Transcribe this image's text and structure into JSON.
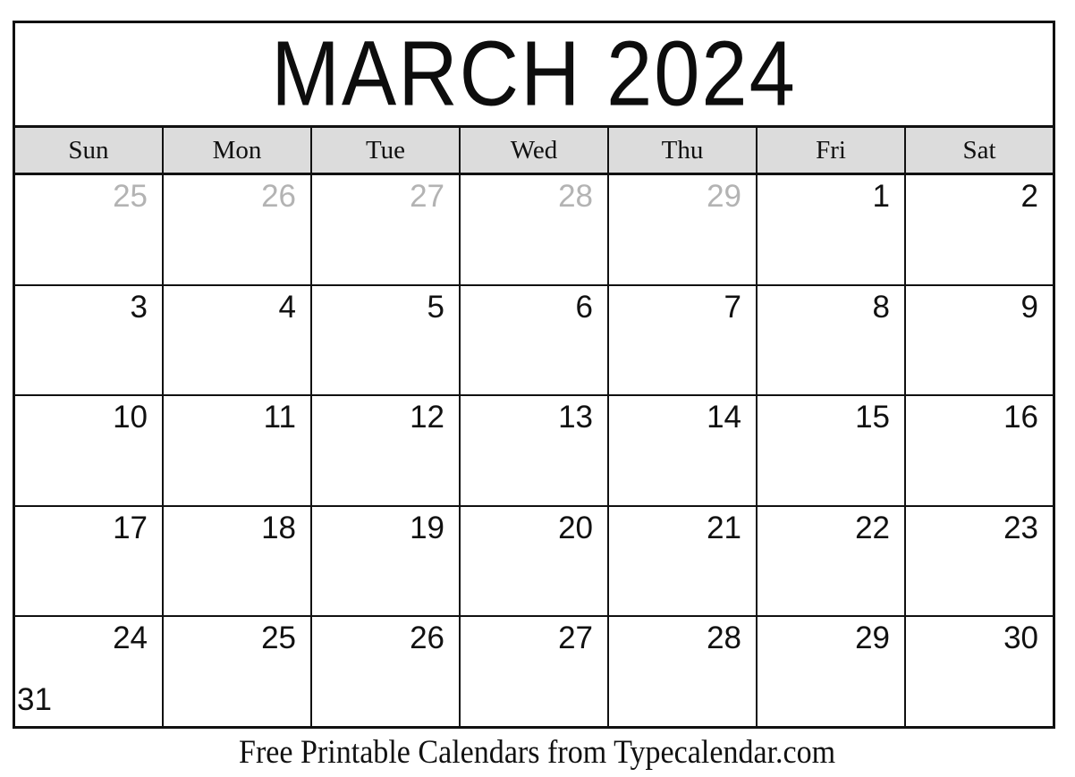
{
  "calendar": {
    "title": "MARCH 2024",
    "month_name": "MARCH",
    "year": "2024",
    "weekday_headers": [
      "Sun",
      "Mon",
      "Tue",
      "Wed",
      "Thu",
      "Fri",
      "Sat"
    ],
    "colors": {
      "border": "#111111",
      "weekday_header_background": "#dcdcdc",
      "current_month_date": "#111111",
      "adjacent_month_date": "#b3b3b3",
      "page_background": "#ffffff"
    },
    "weeks": [
      {
        "days": [
          {
            "number": "25",
            "month": "previous"
          },
          {
            "number": "26",
            "month": "previous"
          },
          {
            "number": "27",
            "month": "previous"
          },
          {
            "number": "28",
            "month": "previous"
          },
          {
            "number": "29",
            "month": "previous"
          },
          {
            "number": "1",
            "month": "current"
          },
          {
            "number": "2",
            "month": "current"
          }
        ]
      },
      {
        "days": [
          {
            "number": "3",
            "month": "current"
          },
          {
            "number": "4",
            "month": "current"
          },
          {
            "number": "5",
            "month": "current"
          },
          {
            "number": "6",
            "month": "current"
          },
          {
            "number": "7",
            "month": "current"
          },
          {
            "number": "8",
            "month": "current"
          },
          {
            "number": "9",
            "month": "current"
          }
        ]
      },
      {
        "days": [
          {
            "number": "10",
            "month": "current"
          },
          {
            "number": "11",
            "month": "current"
          },
          {
            "number": "12",
            "month": "current"
          },
          {
            "number": "13",
            "month": "current"
          },
          {
            "number": "14",
            "month": "current"
          },
          {
            "number": "15",
            "month": "current"
          },
          {
            "number": "16",
            "month": "current"
          }
        ]
      },
      {
        "days": [
          {
            "number": "17",
            "month": "current"
          },
          {
            "number": "18",
            "month": "current"
          },
          {
            "number": "19",
            "month": "current"
          },
          {
            "number": "20",
            "month": "current"
          },
          {
            "number": "21",
            "month": "current"
          },
          {
            "number": "22",
            "month": "current"
          },
          {
            "number": "23",
            "month": "current"
          }
        ]
      },
      {
        "days": [
          {
            "number": "24",
            "month": "current",
            "overflow_number": "31"
          },
          {
            "number": "25",
            "month": "current"
          },
          {
            "number": "26",
            "month": "current"
          },
          {
            "number": "27",
            "month": "current"
          },
          {
            "number": "28",
            "month": "current"
          },
          {
            "number": "29",
            "month": "current"
          },
          {
            "number": "30",
            "month": "current"
          }
        ]
      }
    ]
  },
  "footer": {
    "text": "Free Printable Calendars from Typecalendar.com"
  }
}
